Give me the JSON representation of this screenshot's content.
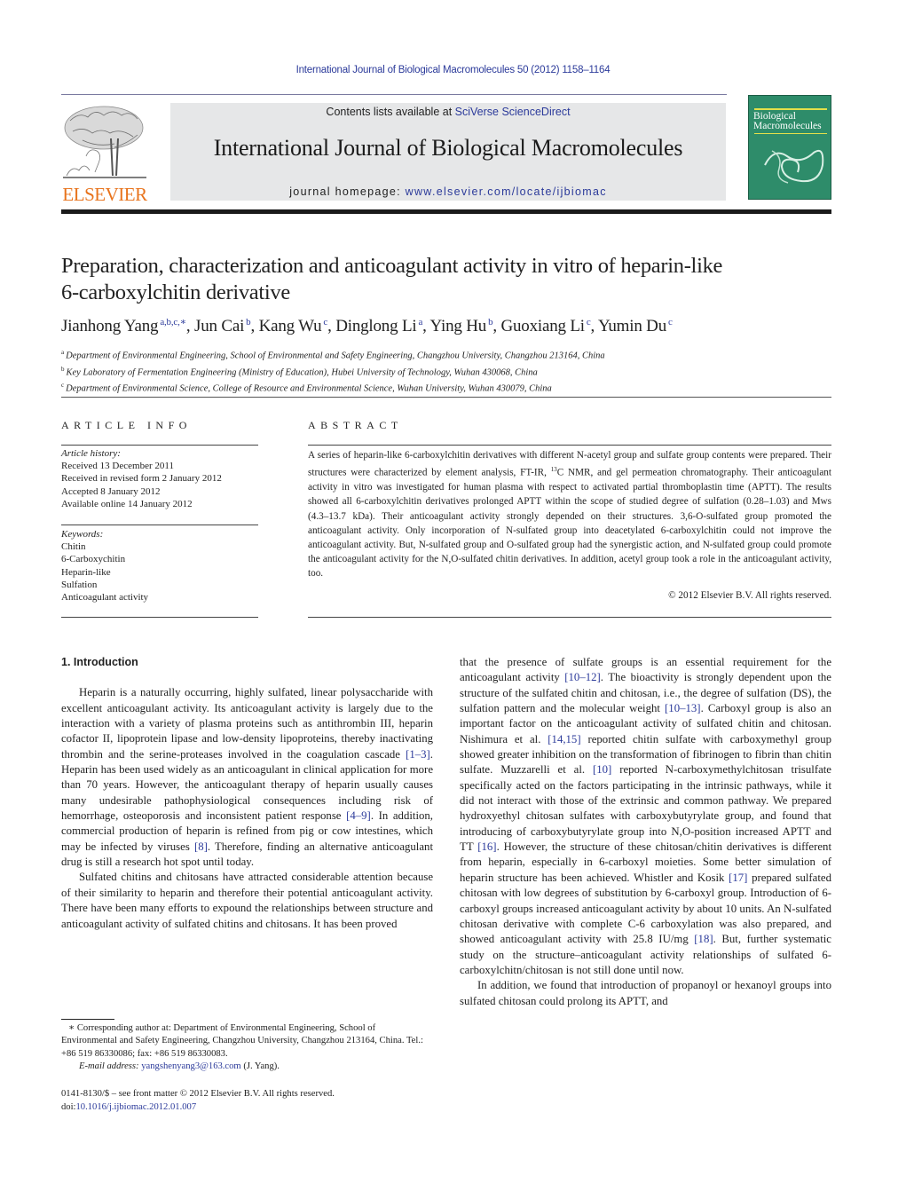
{
  "running_header": "International Journal of Biological Macromolecules 50 (2012) 1158–1164",
  "masthead": {
    "publisher_logo_text": "ELSEVIER",
    "contents_prefix": "Contents lists available at ",
    "contents_link": "SciVerse ScienceDirect",
    "journal_name": "International Journal of Biological Macromolecules",
    "homepage_prefix": "journal homepage: ",
    "homepage_link": "www.elsevier.com/locate/ijbiomac",
    "cover_title_line1": "Biological",
    "cover_title_line2": "Macromolecules",
    "colors": {
      "elsevier_orange": "#e8731c",
      "link_blue": "#2b3a9a",
      "cover_green": "#2e8c6a",
      "masthead_gray": "#e6e7e8"
    }
  },
  "article": {
    "title_line1": "Preparation, characterization and anticoagulant activity in vitro of heparin-like",
    "title_line2": "6-carboxylchitin derivative",
    "authors": [
      {
        "name": "Jianhong Yang",
        "sup": "a,b,c,∗",
        "sep": ", "
      },
      {
        "name": "Jun Cai",
        "sup": "b",
        "sep": ", "
      },
      {
        "name": "Kang Wu",
        "sup": "c",
        "sep": ", "
      },
      {
        "name": "Dinglong Li",
        "sup": "a",
        "sep": ", "
      },
      {
        "name": "Ying Hu",
        "sup": "b",
        "sep": ", "
      },
      {
        "name": "Guoxiang Li",
        "sup": "c",
        "sep": ", "
      },
      {
        "name": "Yumin Du",
        "sup": "c",
        "sep": ""
      }
    ],
    "affiliations": [
      {
        "key": "a",
        "text": "Department of Environmental Engineering, School of Environmental and Safety Engineering, Changzhou University, Changzhou 213164, China"
      },
      {
        "key": "b",
        "text": "Key Laboratory of Fermentation Engineering (Ministry of Education), Hubei University of Technology, Wuhan 430068, China"
      },
      {
        "key": "c",
        "text": "Department of Environmental Science, College of Resource and Environmental Science, Wuhan University, Wuhan 430079, China"
      }
    ]
  },
  "article_info": {
    "heading": "ARTICLE INFO",
    "history_label": "Article history:",
    "history": [
      "Received 13 December 2011",
      "Received in revised form 2 January 2012",
      "Accepted 8 January 2012",
      "Available online 14 January 2012"
    ],
    "keywords_label": "Keywords:",
    "keywords": [
      "Chitin",
      "6-Carboxychitin",
      "Heparin-like",
      "Sulfation",
      "Anticoagulant activity"
    ]
  },
  "abstract": {
    "heading": "ABSTRACT",
    "text_part1": "A series of heparin-like 6-carboxylchitin derivatives with different N-acetyl group and sulfate group contents were prepared. Their structures were characterized by element analysis, FT-IR, ",
    "sup": "13",
    "text_part2": "C NMR, and gel permeation chromatography. Their anticoagulant activity in vitro was investigated for human plasma with respect to activated partial thromboplastin time (APTT). The results showed all 6-carboxylchitin derivatives prolonged APTT within the scope of studied degree of sulfation (0.28–1.03) and Mws (4.3–13.7 kDa). Their anticoagulant activity strongly depended on their structures. 3,6-O-sulfated group promoted the anticoagulant activity. Only incorporation of N-sulfated group into deacetylated 6-carboxylchitin could not improve the anticoagulant activity. But, N-sulfated group and O-sulfated group had the synergistic action, and N-sulfated group could promote the anticoagulant activity for the N,O-sulfated chitin derivatives. In addition, acetyl group took a role in the anticoagulant activity, too.",
    "copyright": "© 2012 Elsevier B.V. All rights reserved."
  },
  "body": {
    "section_heading": "1.  Introduction",
    "left_p1": [
      "Heparin is a naturally occurring, highly sulfated, linear polysaccharide with excellent anticoagulant activity. Its anticoagulant activity is largely due to the interaction with a variety of plasma proteins such as antithrombin III, heparin cofactor II, lipoprotein lipase and low-density lipoproteins, thereby inactivating thrombin and the serine-proteases involved in the coagulation cascade ",
      "[1–3]",
      ". Heparin has been used widely as an anticoagulant in clinical application for more than 70 years. However, the anticoagulant therapy of heparin usually causes many undesirable pathophysiological consequences including risk of hemorrhage, osteoporosis and inconsistent patient response ",
      "[4–9]",
      ". In addition, commercial production of heparin is refined from pig or cow intestines, which may be infected by viruses ",
      "[8]",
      ". Therefore, finding an alternative anticoagulant drug is still a research hot spot until today."
    ],
    "left_p2": "Sulfated chitins and chitosans have attracted considerable attention because of their similarity to heparin and therefore their potential anticoagulant activity. There have been many efforts to expound the relationships between structure and anticoagulant activity of sulfated chitins and chitosans. It has been proved",
    "right_p1": [
      "that the presence of sulfate groups is an essential requirement for the anticoagulant activity ",
      "[10–12]",
      ". The bioactivity is strongly dependent upon the structure of the sulfated chitin and chitosan, i.e., the degree of sulfation (DS), the sulfation pattern and the molecular weight ",
      "[10–13]",
      ". Carboxyl group is also an important factor on the anticoagulant activity of sulfated chitin and chitosan. Nishimura et al. ",
      "[14,15]",
      " reported chitin sulfate with carboxymethyl group showed greater inhibition on the transformation of fibrinogen to fibrin than chitin sulfate. Muzzarelli et al. ",
      "[10]",
      " reported N-carboxymethylchitosan trisulfate specifically acted on the factors participating in the intrinsic pathways, while it did not interact with those of the extrinsic and common pathway. We prepared hydroxyethyl chitosan sulfates with carboxybutyrylate group, and found that introducing of carboxybutyrylate group into N,O-position increased APTT and TT ",
      "[16]",
      ". However, the structure of these chitosan/chitin derivatives is different from heparin, especially in 6-carboxyl moieties. Some better simulation of heparin structure has been achieved. Whistler and Kosik ",
      "[17]",
      " prepared sulfated chitosan with low degrees of substitution by 6-carboxyl group. Introduction of 6-carboxyl groups increased anticoagulant activity by about 10 units. An N-sulfated chitosan derivative with complete C-6 carboxylation was also prepared, and showed anticoagulant activity with 25.8 IU/mg ",
      "[18]",
      ". But, further systematic study on the structure–anticoagulant activity relationships of sulfated 6-carboxylchitn/chitosan is not still done until now."
    ],
    "right_p2": "In addition, we found that introduction of propanoyl or hexanoyl groups into sulfated chitosan could prolong its APTT, and"
  },
  "footnote": {
    "corresponding": "∗  Corresponding author at: Department of Environmental Engineering, School of Environmental and Safety Engineering, Changzhou University, Changzhou 213164, China. Tel.: +86 519 86330086; fax: +86 519 86330083.",
    "email_label": "E-mail address: ",
    "email": "yangshenyang3@163.com",
    "email_suffix": " (J. Yang)."
  },
  "front_matter": {
    "issn_line": "0141-8130/$ – see front matter © 2012 Elsevier B.V. All rights reserved.",
    "doi_prefix": "doi:",
    "doi": "10.1016/j.ijbiomac.2012.01.007"
  }
}
